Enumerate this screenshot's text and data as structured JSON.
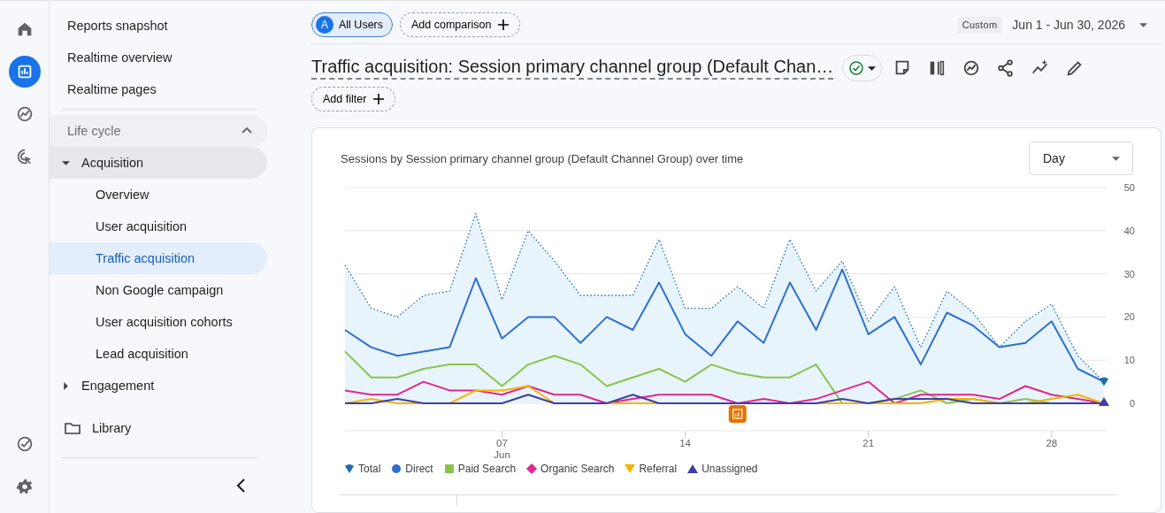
{
  "rail": {
    "items": [
      {
        "kind": "home",
        "selected": false
      },
      {
        "kind": "reports",
        "selected": true
      },
      {
        "kind": "explore",
        "selected": false
      },
      {
        "kind": "advertising",
        "selected": false
      }
    ],
    "bottom_items": [
      {
        "kind": "configure",
        "selected": false
      },
      {
        "kind": "admin",
        "selected": false
      }
    ]
  },
  "nav": {
    "top_items": [
      {
        "label": "Reports snapshot",
        "selected": false
      },
      {
        "label": "Realtime overview",
        "selected": false
      },
      {
        "label": "Realtime pages",
        "selected": false
      }
    ],
    "section": {
      "label": "Life cycle",
      "expanded": true,
      "children": [
        {
          "label": "Acquisition",
          "expanded": true,
          "children": [
            {
              "label": "Overview",
              "selected": false
            },
            {
              "label": "User acquisition",
              "selected": false
            },
            {
              "label": "Traffic acquisition",
              "selected": true
            },
            {
              "label": "Non Google campaign",
              "selected": false
            },
            {
              "label": "User acquisition cohorts",
              "selected": false
            },
            {
              "label": "Lead acquisition",
              "selected": false
            }
          ]
        },
        {
          "label": "Engagement",
          "expanded": false
        }
      ]
    },
    "library": "Library"
  },
  "header": {
    "segment": {
      "badge": "A",
      "label": "All Users"
    },
    "add_comparison": "Add comparison",
    "date_label": "Custom",
    "date_range": "Jun 1 - Jun 30, 2026",
    "title": "Traffic acquisition: Session primary channel group (Default Chan…",
    "add_filter": "Add filter"
  },
  "card": {
    "title": "Sessions by Session primary channel group (Default Channel Group) over time",
    "granularity": "Day",
    "has_annotation": true,
    "chart_data": {
      "type": "line",
      "x": [
        1,
        2,
        3,
        4,
        5,
        6,
        7,
        8,
        9,
        10,
        11,
        12,
        13,
        14,
        15,
        16,
        17,
        18,
        19,
        20,
        21,
        22,
        23,
        24,
        25,
        26,
        27,
        28,
        29,
        30
      ],
      "xticks": [
        {
          "value": 7,
          "label": "07 Jun"
        },
        {
          "value": 14,
          "label": "14"
        },
        {
          "value": 21,
          "label": "21"
        },
        {
          "value": 28,
          "label": "28"
        }
      ],
      "yticks": [
        0,
        10,
        20,
        30,
        40,
        50
      ],
      "ylim": [
        0,
        50
      ],
      "xlim": [
        1,
        30
      ],
      "grid": true,
      "series": [
        {
          "name": "Total",
          "color": "#1b6fa8",
          "type": "area",
          "line_style": "dotted",
          "values": [
            32,
            22,
            20,
            25,
            26,
            44,
            24,
            40,
            33,
            25,
            25,
            25,
            38,
            22,
            22,
            27,
            22,
            38,
            26,
            33,
            19,
            27,
            13,
            26,
            21,
            13,
            19,
            23,
            11,
            5
          ]
        },
        {
          "name": "Direct",
          "color": "#2f6fcf",
          "values": [
            17,
            13,
            11,
            12,
            13,
            29,
            15,
            20,
            20,
            14,
            20,
            17,
            28,
            16,
            11,
            19,
            14,
            28,
            17,
            31,
            16,
            20,
            9,
            21,
            18,
            13,
            14,
            19,
            8,
            5
          ]
        },
        {
          "name": "Paid Search",
          "color": "#8bc34a",
          "values": [
            12,
            6,
            6,
            8,
            9,
            9,
            4,
            9,
            11,
            9,
            4,
            6,
            8,
            5,
            9,
            7,
            6,
            6,
            9,
            0,
            0,
            1,
            3,
            0,
            1,
            0,
            1,
            0,
            0,
            0
          ]
        },
        {
          "name": "Organic Search",
          "color": "#e0268f",
          "values": [
            3,
            2,
            2,
            5,
            3,
            3,
            2,
            4,
            2,
            2,
            0,
            1,
            2,
            2,
            2,
            0,
            1,
            0,
            1,
            3,
            5,
            0,
            2,
            2,
            2,
            1,
            4,
            2,
            1,
            0
          ]
        },
        {
          "name": "Referral",
          "color": "#f5b400",
          "values": [
            0,
            1,
            0,
            0,
            0,
            3,
            3,
            4,
            0,
            0,
            0,
            0,
            0,
            0,
            0,
            0,
            0,
            0,
            0,
            0,
            0,
            0,
            0,
            1,
            1,
            0,
            0,
            1,
            2,
            0
          ]
        },
        {
          "name": "Unassigned",
          "color": "#3f3fa5",
          "values": [
            0,
            0,
            1,
            0,
            0,
            0,
            0,
            2,
            0,
            0,
            0,
            2,
            0,
            0,
            0,
            0,
            0,
            0,
            0,
            1,
            0,
            1,
            1,
            1,
            0,
            0,
            0,
            0,
            0,
            0
          ]
        }
      ]
    }
  }
}
